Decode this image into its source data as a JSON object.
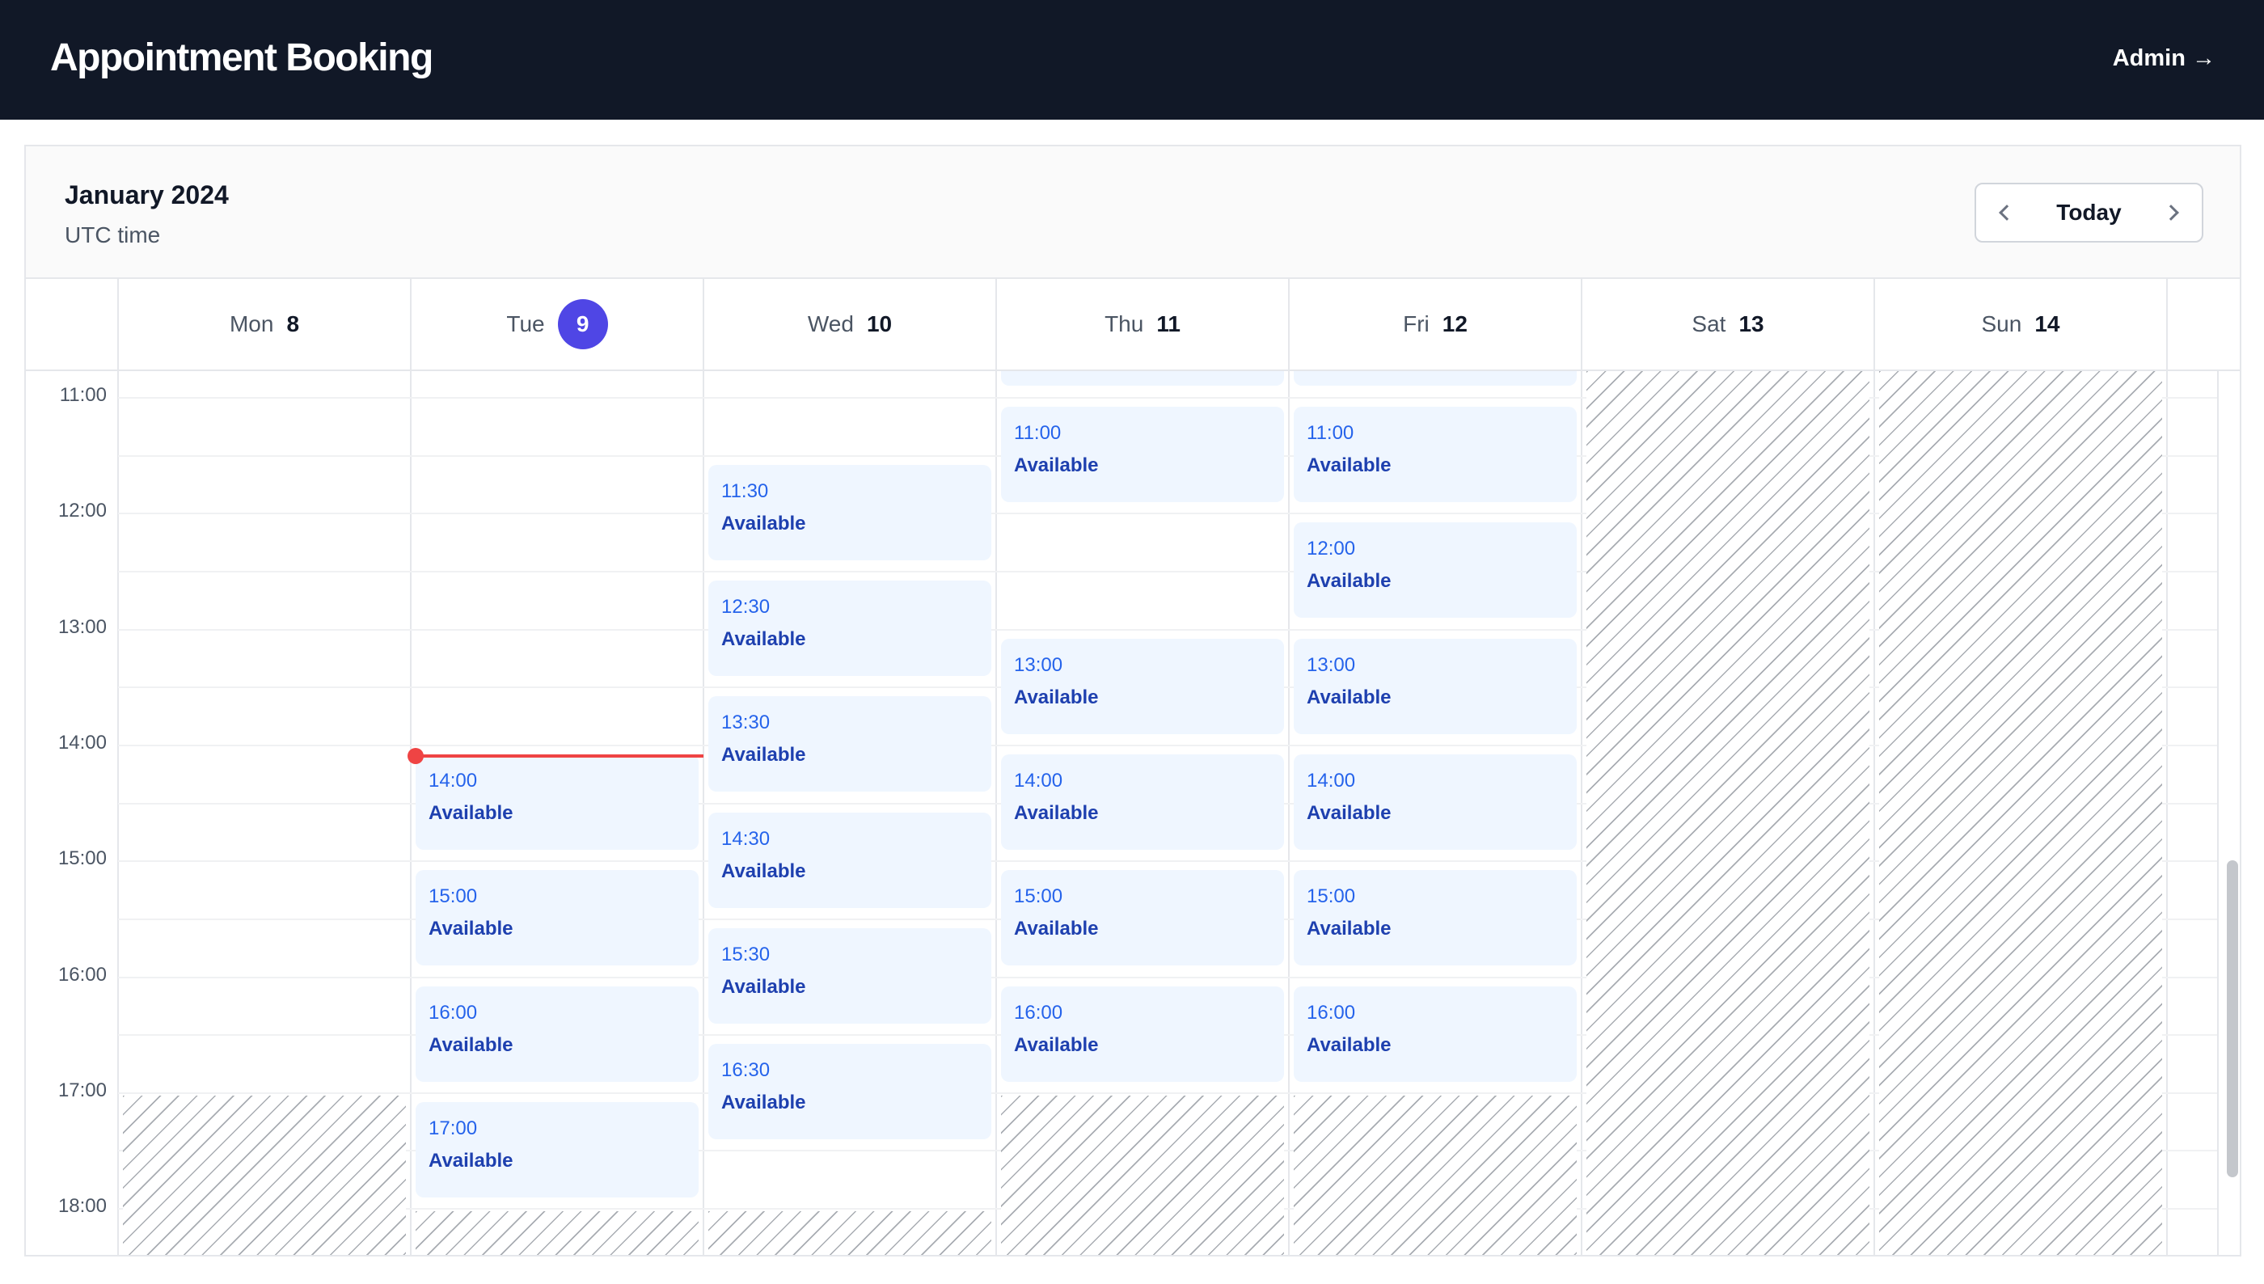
{
  "header": {
    "title": "Appointment Booking",
    "admin_link": "Admin →"
  },
  "calendar": {
    "month": "January 2024",
    "timezone": "UTC time",
    "nav": {
      "prev_icon": "chevron-left-icon",
      "today": "Today",
      "next_icon": "chevron-right-icon"
    },
    "days": [
      {
        "name": "Mon",
        "num": "8",
        "today": false
      },
      {
        "name": "Tue",
        "num": "9",
        "today": true
      },
      {
        "name": "Wed",
        "num": "10",
        "today": false
      },
      {
        "name": "Thu",
        "num": "11",
        "today": false
      },
      {
        "name": "Fri",
        "num": "12",
        "today": false
      },
      {
        "name": "Sat",
        "num": "13",
        "today": false
      },
      {
        "name": "Sun",
        "num": "14",
        "today": false
      }
    ],
    "hours": [
      "11:00",
      "12:00",
      "13:00",
      "14:00",
      "15:00",
      "16:00",
      "17:00",
      "18:00"
    ],
    "slots": [
      {
        "day": 1,
        "time": "14:00",
        "status": "Available"
      },
      {
        "day": 1,
        "time": "15:00",
        "status": "Available"
      },
      {
        "day": 1,
        "time": "16:00",
        "status": "Available"
      },
      {
        "day": 1,
        "time": "17:00",
        "status": "Available"
      },
      {
        "day": 2,
        "time": "11:30",
        "status": "Available"
      },
      {
        "day": 2,
        "time": "12:30",
        "status": "Available"
      },
      {
        "day": 2,
        "time": "13:30",
        "status": "Available"
      },
      {
        "day": 2,
        "time": "14:30",
        "status": "Available"
      },
      {
        "day": 2,
        "time": "15:30",
        "status": "Available"
      },
      {
        "day": 2,
        "time": "16:30",
        "status": "Available"
      },
      {
        "day": 3,
        "time": "11:00",
        "status": "Available"
      },
      {
        "day": 3,
        "time": "13:00",
        "status": "Available"
      },
      {
        "day": 3,
        "time": "14:00",
        "status": "Available"
      },
      {
        "day": 3,
        "time": "15:00",
        "status": "Available"
      },
      {
        "day": 3,
        "time": "16:00",
        "status": "Available"
      },
      {
        "day": 4,
        "time": "11:00",
        "status": "Available"
      },
      {
        "day": 4,
        "time": "12:00",
        "status": "Available"
      },
      {
        "day": 4,
        "time": "13:00",
        "status": "Available"
      },
      {
        "day": 4,
        "time": "14:00",
        "status": "Available"
      },
      {
        "day": 4,
        "time": "15:00",
        "status": "Available"
      },
      {
        "day": 4,
        "time": "16:00",
        "status": "Available"
      }
    ],
    "current_time_day": 1,
    "colors": {
      "topbar": "#111827",
      "today_badge": "#4f46e5",
      "slot_bg": "#eff6ff",
      "slot_time": "#2563eb",
      "slot_status": "#1e40af",
      "now_line": "#ef4444"
    }
  }
}
